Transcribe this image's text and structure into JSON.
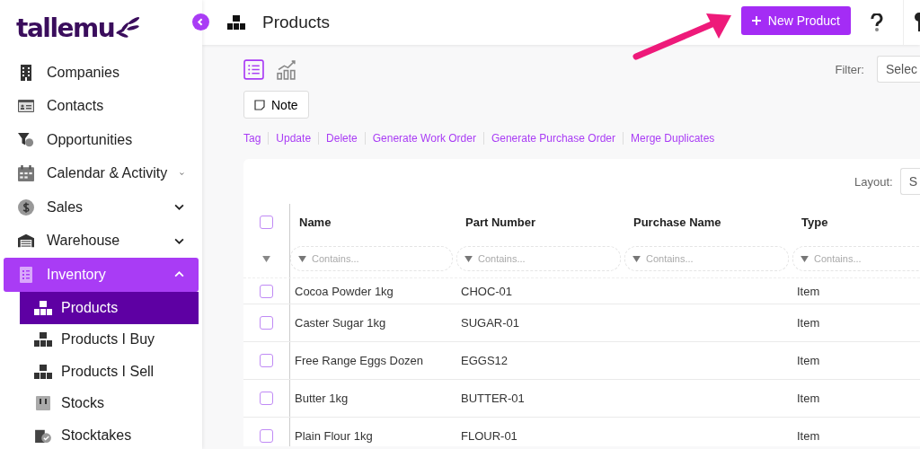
{
  "logo": {
    "text": "tallemu"
  },
  "sidebar": {
    "items": [
      {
        "label": "Companies",
        "selected": false
      },
      {
        "label": "Contacts",
        "selected": false
      },
      {
        "label": "Opportunities",
        "selected": false
      },
      {
        "label": "Calendar & Activity",
        "expanded": false,
        "selected": false
      },
      {
        "label": "Sales",
        "expanded": false,
        "selected": false
      },
      {
        "label": "Warehouse",
        "expanded": false,
        "selected": false
      },
      {
        "label": "Inventory",
        "expanded": true,
        "selected": true,
        "children": [
          {
            "label": "Products",
            "selected": true
          },
          {
            "label": "Products I Buy",
            "selected": false
          },
          {
            "label": "Products I Sell",
            "selected": false
          },
          {
            "label": "Stocks",
            "selected": false
          },
          {
            "label": "Stocktakes",
            "selected": false
          }
        ]
      }
    ]
  },
  "header": {
    "title": "Products",
    "new_button": "New Product"
  },
  "toolbar": {
    "views": [
      {
        "selected": true
      },
      {
        "selected": false
      }
    ],
    "filter_label": "Filter:",
    "filter_value": "Selec",
    "note_button": "Note",
    "actions": [
      "Tag",
      "Update",
      "Delete",
      "Generate Work Order",
      "Generate Purchase Order",
      "Merge Duplicates"
    ]
  },
  "table": {
    "layout_label": "Layout:",
    "layout_value": "S",
    "select_all": {
      "selected": false
    },
    "columns": [
      {
        "label": "Name",
        "filter_placeholder": "Contains..."
      },
      {
        "label": "Part Number",
        "filter_placeholder": "Contains..."
      },
      {
        "label": "Purchase Name",
        "filter_placeholder": "Contains..."
      },
      {
        "label": "Type",
        "filter_placeholder": "Contains..."
      }
    ],
    "rows": [
      {
        "cells": [
          "Cocoa Powder 1kg",
          "CHOC-01",
          "",
          "Item"
        ],
        "selected": false
      },
      {
        "cells": [
          "Caster Sugar 1kg",
          "SUGAR-01",
          "",
          "Item"
        ],
        "selected": false
      },
      {
        "cells": [
          "Free Range Eggs Dozen",
          "EGGS12",
          "",
          "Item"
        ],
        "selected": false
      },
      {
        "cells": [
          "Butter 1kg",
          "BUTTER-01",
          "",
          "Item"
        ],
        "selected": false
      },
      {
        "cells": [
          "Plain Flour 1kg",
          "FLOUR-01",
          "",
          "Item"
        ],
        "selected": false
      }
    ]
  },
  "annotation": {
    "kind": "arrow"
  }
}
